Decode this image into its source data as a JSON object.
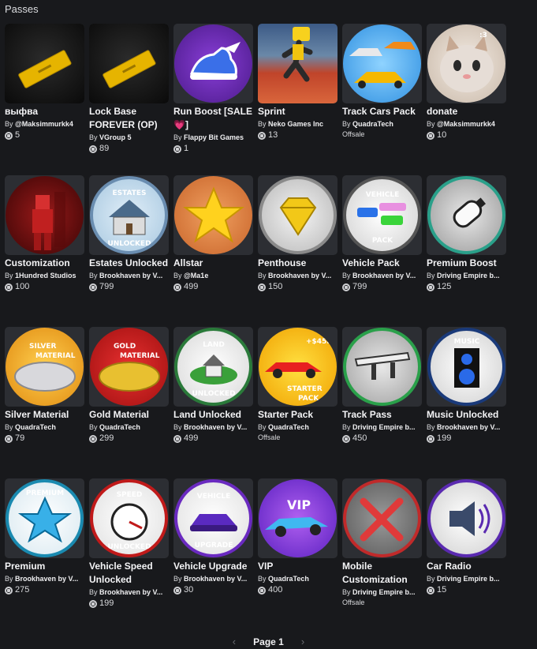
{
  "section": {
    "title": "Passes"
  },
  "passes": [
    {
      "name": "выфва",
      "by": "By",
      "creator": "@Maksimmurkk4",
      "price": "5",
      "offsale": ""
    },
    {
      "name": "Lock Base FOREVER (OP)",
      "by": "By",
      "creator": "VGroup 5",
      "price": "89",
      "offsale": ""
    },
    {
      "name": "Run Boost [SALE💗]",
      "by": "By",
      "creator": "Flappy Bit Games",
      "price": "1",
      "offsale": ""
    },
    {
      "name": "Sprint",
      "by": "By",
      "creator": "Neko Games Inc",
      "price": "13",
      "offsale": ""
    },
    {
      "name": "Track Cars Pack",
      "by": "By",
      "creator": "QuadraTech",
      "price": "",
      "offsale": "Offsale"
    },
    {
      "name": "donate",
      "by": "By",
      "creator": "@Maksimmurkk4",
      "price": "10",
      "offsale": ""
    },
    {
      "name": "Customization",
      "by": "By",
      "creator": "1Hundred Studios",
      "price": "100",
      "offsale": ""
    },
    {
      "name": "Estates Unlocked",
      "by": "By",
      "creator": "Brookhaven by V...",
      "price": "799",
      "offsale": ""
    },
    {
      "name": "Allstar",
      "by": "By",
      "creator": "@Ma1e",
      "price": "499",
      "offsale": ""
    },
    {
      "name": "Penthouse",
      "by": "By",
      "creator": "Brookhaven by V...",
      "price": "150",
      "offsale": ""
    },
    {
      "name": "Vehicle Pack",
      "by": "By",
      "creator": "Brookhaven by V...",
      "price": "799",
      "offsale": ""
    },
    {
      "name": "Premium Boost",
      "by": "By",
      "creator": "Driving Empire b...",
      "price": "125",
      "offsale": ""
    },
    {
      "name": "Silver Material",
      "by": "By",
      "creator": "QuadraTech",
      "price": "79",
      "offsale": ""
    },
    {
      "name": "Gold Material",
      "by": "By",
      "creator": "QuadraTech",
      "price": "299",
      "offsale": ""
    },
    {
      "name": "Land Unlocked",
      "by": "By",
      "creator": "Brookhaven by V...",
      "price": "499",
      "offsale": ""
    },
    {
      "name": "Starter Pack",
      "by": "By",
      "creator": "QuadraTech",
      "price": "",
      "offsale": "Offsale"
    },
    {
      "name": "Track Pass",
      "by": "By",
      "creator": "Driving Empire b...",
      "price": "450",
      "offsale": ""
    },
    {
      "name": "Music Unlocked",
      "by": "By",
      "creator": "Brookhaven by V...",
      "price": "199",
      "offsale": ""
    },
    {
      "name": "Premium",
      "by": "By",
      "creator": "Brookhaven by V...",
      "price": "275",
      "offsale": ""
    },
    {
      "name": "Vehicle Speed Unlocked",
      "by": "By",
      "creator": "Brookhaven by V...",
      "price": "199",
      "offsale": ""
    },
    {
      "name": "Vehicle Upgrade",
      "by": "By",
      "creator": "Brookhaven by V...",
      "price": "30",
      "offsale": ""
    },
    {
      "name": "VIP",
      "by": "By",
      "creator": "QuadraTech",
      "price": "400",
      "offsale": ""
    },
    {
      "name": "Mobile Customization",
      "by": "By",
      "creator": "Driving Empire b...",
      "price": "",
      "offsale": "Offsale"
    },
    {
      "name": "Car Radio",
      "by": "By",
      "creator": "Driving Empire b...",
      "price": "15",
      "offsale": ""
    }
  ],
  "thumb_text": {
    "estates_top": "ESTATES",
    "estates_bottom": "UNLOCKED",
    "vehicle_top": "VEHICLE",
    "vehicle_bottom": "PACK",
    "silver_a": "SILVER",
    "silver_b": "MATERIAL",
    "gold_a": "GOLD",
    "gold_b": "MATERIAL",
    "land_top": "LAND",
    "land_bottom": "UNLOCKED",
    "starter_a": "+$45K",
    "starter_b": "STARTER",
    "starter_c": "PACK",
    "music": "MUSIC",
    "premium": "PREMIUM",
    "speed_top": "SPEED",
    "speed_bottom": "UNLOCKED",
    "upgrade_top": "VEHICLE",
    "upgrade_bottom": "UPGRADE",
    "vip": "VIP",
    "donate_badge": ":3"
  },
  "pagination": {
    "label": "Page 1",
    "prev_icon": "chevron-left-icon",
    "next_icon": "chevron-right-icon"
  }
}
